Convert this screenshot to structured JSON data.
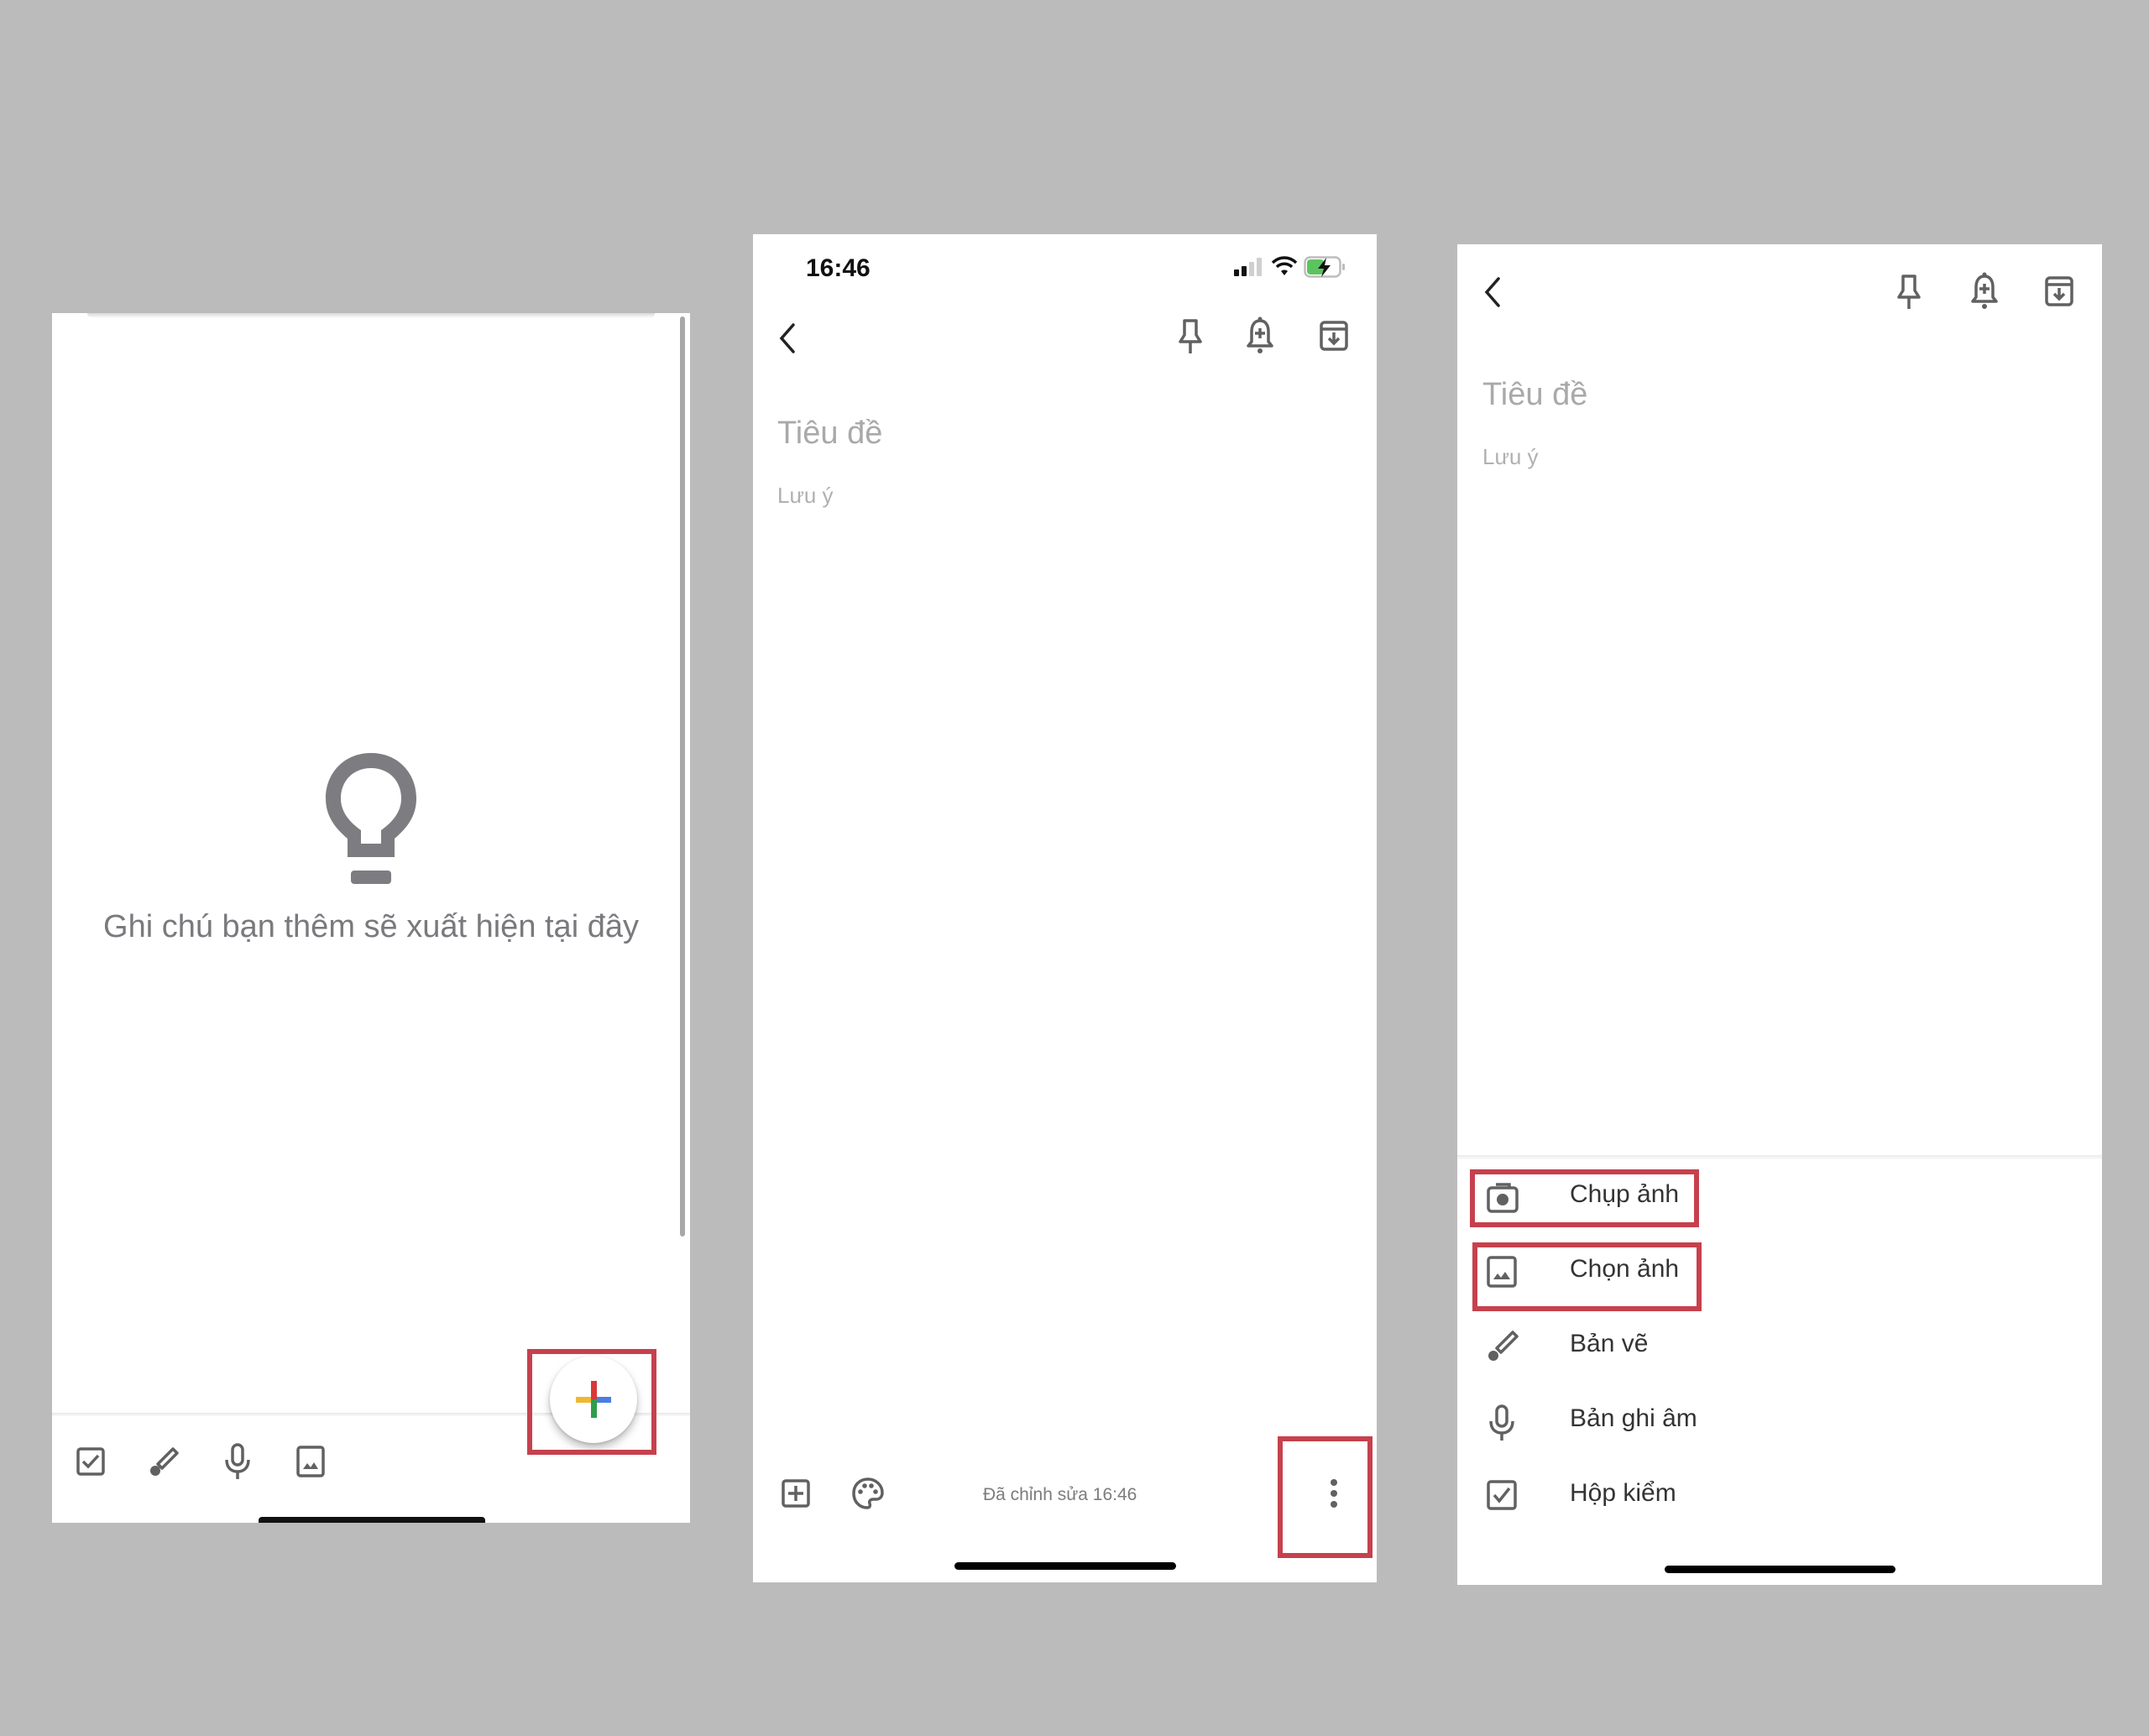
{
  "colors": {
    "background": "#bbbbbb",
    "highlight": "#c6414e",
    "icon_gray": "#616161",
    "placeholder_gray": "#a9a9a9",
    "plus_red": "#d93838",
    "plus_blue": "#4a7ee0",
    "plus_yellow": "#f0b731",
    "plus_green": "#2e9d4c",
    "battery_green": "#5cc45e"
  },
  "panel1": {
    "empty_state": {
      "icon": "lightbulb-icon",
      "text": "Ghi chú bạn thêm sẽ xuất hiện tại đây"
    },
    "fab": {
      "icon": "multicolor-plus-icon",
      "label": "New note"
    },
    "bottom_toolbar": [
      {
        "icon": "checkbox-icon",
        "label": "New list"
      },
      {
        "icon": "brush-icon",
        "label": "New drawing"
      },
      {
        "icon": "microphone-icon",
        "label": "New audio note"
      },
      {
        "icon": "image-icon",
        "label": "New image note"
      }
    ]
  },
  "panel2": {
    "status_bar": {
      "time": "16:46",
      "icons": [
        "signal-icon",
        "wifi-icon",
        "battery-charging-icon"
      ]
    },
    "header": {
      "back_icon": "chevron-left-icon",
      "actions": [
        "pin-icon",
        "reminder-bell-icon",
        "archive-icon"
      ]
    },
    "editor": {
      "title_placeholder": "Tiêu đề",
      "note_placeholder": "Lưu ý"
    },
    "bottom_toolbar": {
      "add_icon": "add-box-icon",
      "palette_icon": "palette-icon",
      "edited_text": "Đã chỉnh sửa 16:46",
      "more_icon": "more-vertical-icon"
    }
  },
  "panel3": {
    "header": {
      "back_icon": "chevron-left-icon",
      "actions": [
        "pin-icon",
        "reminder-bell-icon",
        "archive-icon"
      ]
    },
    "editor": {
      "title_placeholder": "Tiêu đề",
      "note_placeholder": "Lưu ý"
    },
    "menu": [
      {
        "icon": "camera-icon",
        "label": "Chụp ảnh",
        "highlighted": true
      },
      {
        "icon": "image-icon",
        "label": "Chọn ảnh",
        "highlighted": true
      },
      {
        "icon": "brush-icon",
        "label": "Bản vẽ",
        "highlighted": false
      },
      {
        "icon": "microphone-icon",
        "label": "Bản ghi âm",
        "highlighted": false
      },
      {
        "icon": "checkbox-icon",
        "label": "Hộp kiểm",
        "highlighted": false
      }
    ]
  }
}
